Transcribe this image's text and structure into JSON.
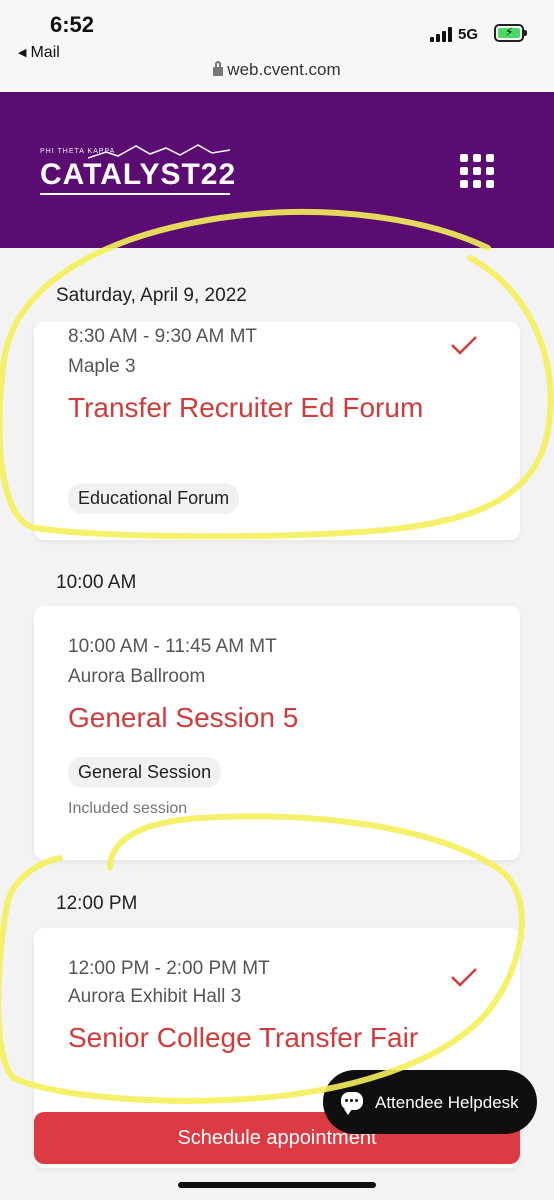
{
  "status": {
    "time": "6:52",
    "back_label": "Mail",
    "network": "5G",
    "url": "web.cvent.com"
  },
  "header": {
    "logo_small": "PHI THETA KAPPA",
    "logo_main": "CATALYST22"
  },
  "colors": {
    "header_bg": "#5b0c72",
    "title_red": "#d23b3b",
    "button_red": "#dc3b43",
    "highlight_yellow": "#f4f05a"
  },
  "groups": [
    {
      "label": "Saturday, April 9, 2022",
      "session": {
        "time": "8:30 AM - 9:30 AM MT",
        "room": "Maple 3",
        "title": "Transfer Recruiter Ed Forum",
        "tag": "Educational Forum",
        "checked": true
      }
    },
    {
      "label": "10:00 AM",
      "session": {
        "time": "10:00 AM - 11:45 AM MT",
        "room": "Aurora Ballroom",
        "title": "General Session 5",
        "tag": "General Session",
        "note": "Included session",
        "checked": false
      }
    },
    {
      "label": "12:00 PM",
      "session": {
        "time": "12:00 PM - 2:00 PM MT",
        "room": "Aurora Exhibit Hall 3",
        "title": "Senior College Transfer Fair",
        "checked": true
      }
    }
  ],
  "helpdesk": {
    "label": "Attendee Helpdesk",
    "icon": "chat-bubble-icon"
  },
  "actions": {
    "schedule_label": "Schedule appointment"
  }
}
